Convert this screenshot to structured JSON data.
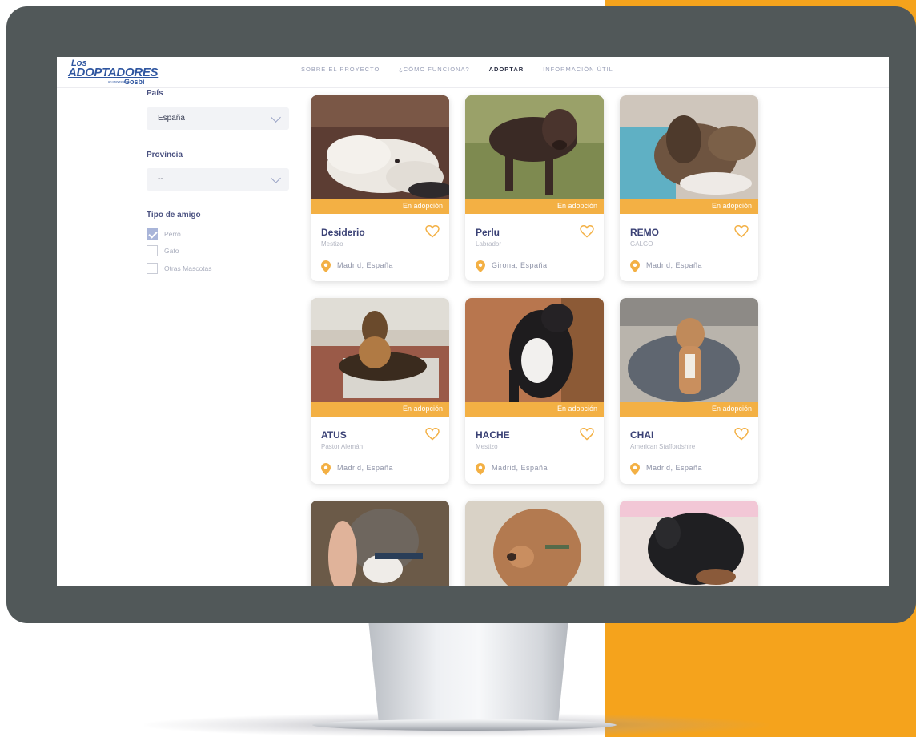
{
  "site": {
    "logo": {
      "top": "Los",
      "main": "ADOPTADORES",
      "sub": "Gosbi",
      "tagline": "un proyecto de"
    },
    "nav": [
      {
        "label": "SOBRE EL PROYECTO",
        "active": false
      },
      {
        "label": "¿CÓMO FUNCIONA?",
        "active": false
      },
      {
        "label": "ADOPTAR",
        "active": true
      },
      {
        "label": "INFORMACIÓN ÚTIL",
        "active": false
      }
    ]
  },
  "filters": {
    "country": {
      "label": "País",
      "value": "España"
    },
    "province": {
      "label": "Provincia",
      "value": "--"
    },
    "type": {
      "label": "Tipo de amigo",
      "options": [
        {
          "label": "Perro",
          "checked": true
        },
        {
          "label": "Gato",
          "checked": false
        },
        {
          "label": "Otras Mascotas",
          "checked": false
        }
      ]
    }
  },
  "pets": [
    {
      "name": "Desiderio",
      "breed": "Mestizo",
      "location": "Madrid, España",
      "status": "En adopción"
    },
    {
      "name": "Perlu",
      "breed": "Labrador",
      "location": "Girona, España",
      "status": "En adopción"
    },
    {
      "name": "REMO",
      "breed": "GALGO",
      "location": "Madrid, España",
      "status": "En adopción"
    },
    {
      "name": "ATUS",
      "breed": "Pastor Alemán",
      "location": "Madrid, España",
      "status": "En adopción"
    },
    {
      "name": "HACHE",
      "breed": "Mestizo",
      "location": "Madrid, España",
      "status": "En adopción"
    },
    {
      "name": "CHAI",
      "breed": "American Staffordshire",
      "location": "Madrid, España",
      "status": "En adopción"
    }
  ],
  "colors": {
    "accent": "#f3b044",
    "brand": "#2f56a0",
    "background_panel": "#f5a31c",
    "bezel": "#515859"
  }
}
